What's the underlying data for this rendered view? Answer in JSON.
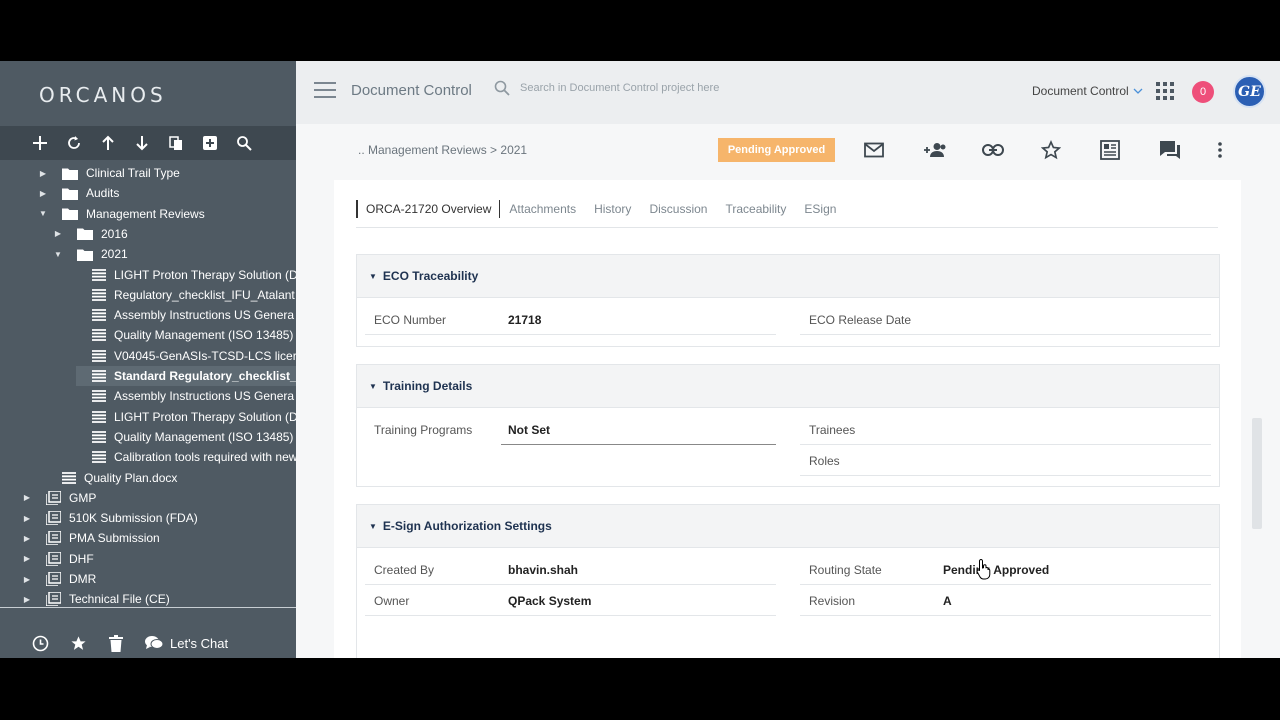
{
  "app": {
    "logo": "ORCANOS",
    "project_title": "Document Control",
    "search_placeholder": "Search in Document Control project here",
    "project_selector": "Document Control",
    "notification_count": "0",
    "avatar_text": "GE"
  },
  "sidebar": {
    "tree": [
      {
        "label": "Clinical Trail Type",
        "level": 1,
        "type": "folder",
        "expand": "collapsed"
      },
      {
        "label": "Audits",
        "level": 1,
        "type": "folder",
        "expand": "collapsed"
      },
      {
        "label": "Management Reviews",
        "level": 1,
        "type": "folder",
        "expand": "expanded"
      },
      {
        "label": "2016",
        "level": 2,
        "type": "folder",
        "expand": "collapsed"
      },
      {
        "label": "2021",
        "level": 2,
        "type": "folder",
        "expand": "expanded"
      },
      {
        "label": "LIGHT Proton Therapy Solution (D",
        "level": 3,
        "type": "doc"
      },
      {
        "label": "Regulatory_checklist_IFU_Atalant",
        "level": 3,
        "type": "doc"
      },
      {
        "label": "Assembly Instructions US Genera",
        "level": 3,
        "type": "doc"
      },
      {
        "label": "Quality Management (ISO 13485)",
        "level": 3,
        "type": "doc"
      },
      {
        "label": "V04045-GenASIs-TCSD-LCS licer",
        "level": 3,
        "type": "doc"
      },
      {
        "label": "Standard Regulatory_checklist_",
        "level": 3,
        "type": "doc",
        "selected": true
      },
      {
        "label": "Assembly Instructions US Genera",
        "level": 3,
        "type": "doc"
      },
      {
        "label": "LIGHT Proton Therapy Solution (D",
        "level": 3,
        "type": "doc"
      },
      {
        "label": "Quality Management (ISO 13485)",
        "level": 3,
        "type": "doc"
      },
      {
        "label": "Calibration tools required with new",
        "level": 3,
        "type": "doc"
      },
      {
        "label": "Quality Plan.docx",
        "level": 1,
        "type": "doc"
      },
      {
        "label": "GMP",
        "level": 0,
        "type": "module",
        "expand": "collapsed"
      },
      {
        "label": "510K Submission (FDA)",
        "level": 0,
        "type": "module",
        "expand": "collapsed"
      },
      {
        "label": "PMA Submission",
        "level": 0,
        "type": "module",
        "expand": "collapsed"
      },
      {
        "label": "DHF",
        "level": 0,
        "type": "module",
        "expand": "collapsed"
      },
      {
        "label": "DMR",
        "level": 0,
        "type": "module",
        "expand": "collapsed"
      },
      {
        "label": "Technical File (CE)",
        "level": 0,
        "type": "module",
        "expand": "collapsed"
      }
    ],
    "chat_label": "Let's Chat"
  },
  "content": {
    "breadcrumb": ".. Management Reviews > 2021",
    "status": "Pending Approved",
    "tabs": [
      "ORCA-21720 Overview",
      "Attachments",
      "History",
      "Discussion",
      "Traceability",
      "ESign"
    ],
    "sections": {
      "eco": {
        "title": "ECO Traceability",
        "eco_number_label": "ECO Number",
        "eco_number_value": "21718",
        "eco_release_label": "ECO Release Date"
      },
      "training": {
        "title": "Training Details",
        "programs_label": "Training Programs",
        "programs_value": "Not Set",
        "trainees_label": "Trainees",
        "roles_label": "Roles"
      },
      "esign": {
        "title": "E-Sign Authorization Settings",
        "created_by_label": "Created By",
        "created_by_value": "bhavin.shah",
        "routing_label": "Routing State",
        "routing_value": "Pending Approved",
        "owner_label": "Owner",
        "owner_value": "QPack System",
        "revision_label": "Revision",
        "revision_value": "A"
      }
    }
  },
  "colors": {
    "sidebar_bg": "#4f5a63",
    "toolbar_bg": "#3e4850",
    "status_pill": "#f6b56b",
    "badge": "#ee4f7a",
    "section_title": "#1e3250"
  }
}
